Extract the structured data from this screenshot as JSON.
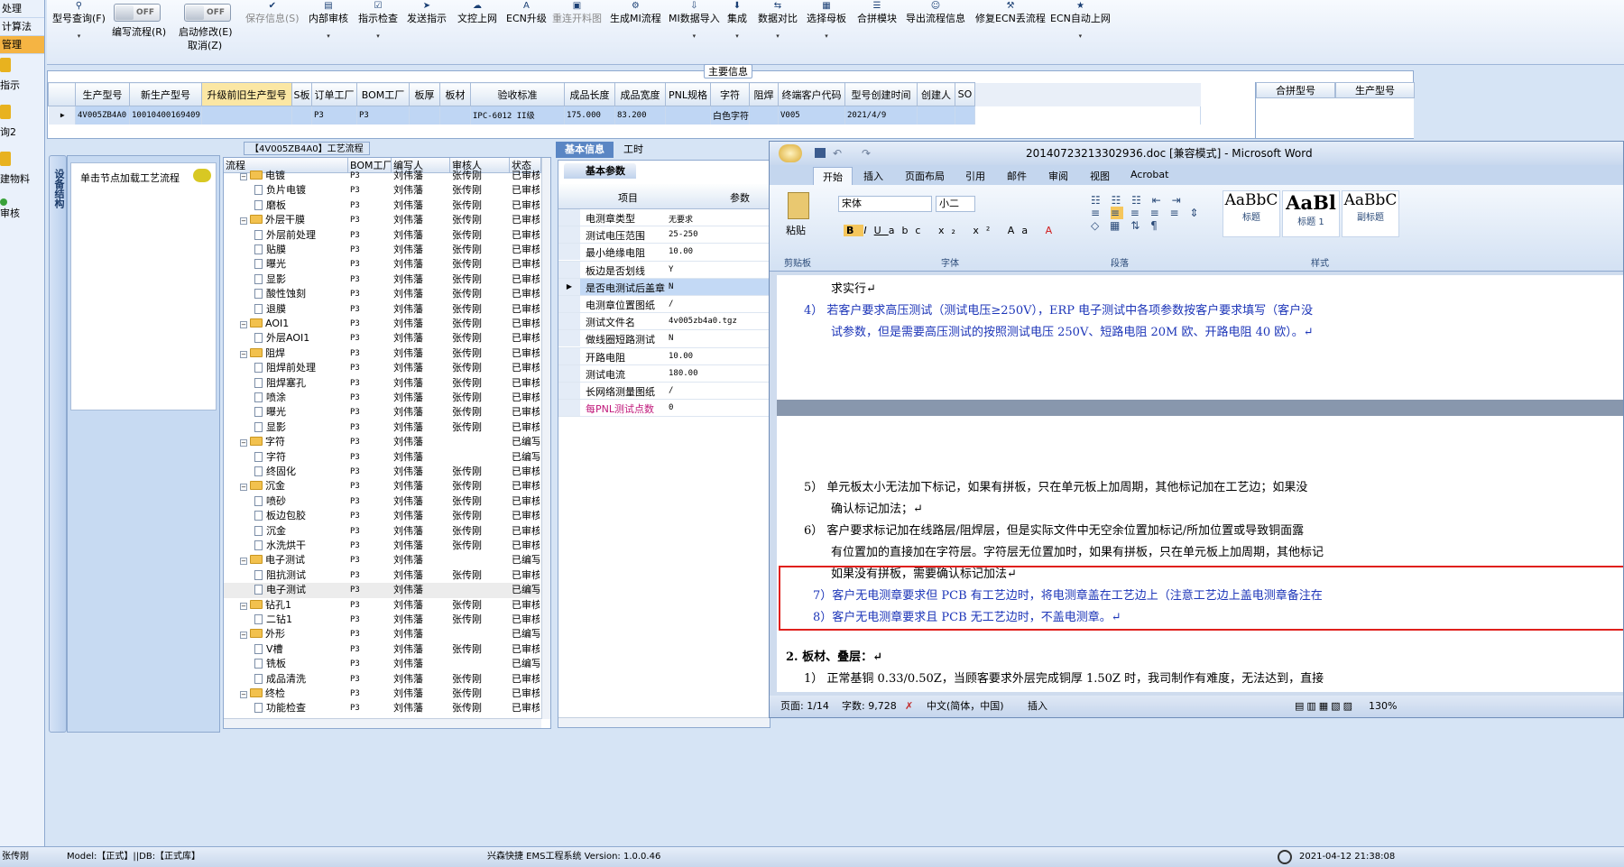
{
  "left_nav": {
    "items": [
      "处理",
      "计算法",
      "管理"
    ],
    "icon_items": [
      "指示",
      "询2",
      "建物料",
      "审核"
    ]
  },
  "toolbar": {
    "buttons": [
      {
        "label": "型号查询(F)",
        "icon": "search-icon",
        "disabled": false
      },
      {
        "label": "编写流程(R)",
        "icon": "toggle",
        "disabled": false
      },
      {
        "label": "启动修改(E)",
        "icon": "toggle",
        "disabled": false
      },
      {
        "label": "保存信息(S)",
        "icon": "check-icon",
        "disabled": true
      },
      {
        "label": "内部审核",
        "icon": "printer-icon",
        "disabled": false
      },
      {
        "label": "指示检查",
        "icon": "check-icon",
        "disabled": false
      },
      {
        "label": "发送指示",
        "icon": "send-icon",
        "disabled": false
      },
      {
        "label": "文控上网",
        "icon": "cloud-icon",
        "disabled": false
      },
      {
        "label": "ECN升级",
        "icon": "font-icon",
        "disabled": false
      },
      {
        "label": "重连开料图",
        "icon": "image-icon",
        "disabled": true
      },
      {
        "label": "生成MI流程",
        "icon": "gear-icon",
        "disabled": false
      },
      {
        "label": "MI数据导入",
        "icon": "import-icon",
        "disabled": false
      },
      {
        "label": "集成",
        "icon": "download-icon",
        "disabled": false
      },
      {
        "label": "数据对比",
        "icon": "compare-icon",
        "disabled": false
      },
      {
        "label": "选择母板",
        "icon": "board-icon",
        "disabled": false
      },
      {
        "label": "合拼模块",
        "icon": "list-icon",
        "disabled": false
      },
      {
        "label": "导出流程信息",
        "icon": "smile-icon",
        "disabled": false
      },
      {
        "label": "修复ECN丢流程",
        "icon": "wrench-icon",
        "disabled": false
      },
      {
        "label": "ECN自动上网",
        "icon": "star-icon",
        "disabled": false
      }
    ],
    "toggle_text": "OFF",
    "cancel_label": "取消(Z)"
  },
  "main_info": {
    "title": "主要信息",
    "columns": [
      "生产型号",
      "新生产型号",
      "升级前旧生产型号",
      "S板",
      "订单工厂",
      "BOM工厂",
      "板厚",
      "板材",
      "验收标准",
      "成品长度",
      "成品宽度",
      "PNL规格",
      "字符",
      "阻焊",
      "终端客户代码",
      "型号创建时间",
      "创建人",
      "SO"
    ],
    "row": [
      "4V005ZB4A0",
      "10010400169409",
      "",
      "",
      "P3",
      "P3",
      "",
      "",
      "IPC-6012 II级",
      "175.000",
      "83.200",
      "",
      "白色字符",
      "",
      "V005",
      "2021/4/9",
      "",
      ""
    ],
    "side_columns": [
      "合拼型号",
      "生产型号"
    ]
  },
  "node_panel": {
    "vtab_label": "设备结构",
    "node_label": "单击节点加载工艺流程"
  },
  "flow": {
    "title": "【4V005ZB4A0】工艺流程",
    "columns": [
      "流程",
      "BOM工厂",
      "编写人",
      "审核人",
      "状态"
    ],
    "rows": [
      {
        "name": "电镀",
        "level": 1,
        "type": "folder",
        "bom": "P3",
        "writer": "刘伟藩",
        "auditor": "张传刚",
        "status": "已审核"
      },
      {
        "name": "负片电镀",
        "level": 2,
        "type": "doc",
        "bom": "P3",
        "writer": "刘伟藩",
        "auditor": "张传刚",
        "status": "已审核"
      },
      {
        "name": "磨板",
        "level": 2,
        "type": "doc",
        "bom": "P3",
        "writer": "刘伟藩",
        "auditor": "张传刚",
        "status": "已审核"
      },
      {
        "name": "外层干膜",
        "level": 1,
        "type": "folder",
        "bom": "P3",
        "writer": "刘伟藩",
        "auditor": "张传刚",
        "status": "已审核"
      },
      {
        "name": "外层前处理",
        "level": 2,
        "type": "doc",
        "bom": "P3",
        "writer": "刘伟藩",
        "auditor": "张传刚",
        "status": "已审核"
      },
      {
        "name": "贴膜",
        "level": 2,
        "type": "doc",
        "bom": "P3",
        "writer": "刘伟藩",
        "auditor": "张传刚",
        "status": "已审核"
      },
      {
        "name": "曝光",
        "level": 2,
        "type": "doc",
        "bom": "P3",
        "writer": "刘伟藩",
        "auditor": "张传刚",
        "status": "已审核"
      },
      {
        "name": "显影",
        "level": 2,
        "type": "doc",
        "bom": "P3",
        "writer": "刘伟藩",
        "auditor": "张传刚",
        "status": "已审核"
      },
      {
        "name": "酸性蚀刻",
        "level": 2,
        "type": "doc",
        "bom": "P3",
        "writer": "刘伟藩",
        "auditor": "张传刚",
        "status": "已审核"
      },
      {
        "name": "退膜",
        "level": 2,
        "type": "doc",
        "bom": "P3",
        "writer": "刘伟藩",
        "auditor": "张传刚",
        "status": "已审核"
      },
      {
        "name": "AOI1",
        "level": 1,
        "type": "folder",
        "bom": "P3",
        "writer": "刘伟藩",
        "auditor": "张传刚",
        "status": "已审核"
      },
      {
        "name": "外层AOI1",
        "level": 2,
        "type": "doc",
        "bom": "P3",
        "writer": "刘伟藩",
        "auditor": "张传刚",
        "status": "已审核"
      },
      {
        "name": "阻焊",
        "level": 1,
        "type": "folder",
        "bom": "P3",
        "writer": "刘伟藩",
        "auditor": "张传刚",
        "status": "已审核"
      },
      {
        "name": "阻焊前处理",
        "level": 2,
        "type": "doc",
        "bom": "P3",
        "writer": "刘伟藩",
        "auditor": "张传刚",
        "status": "已审核"
      },
      {
        "name": "阻焊塞孔",
        "level": 2,
        "type": "doc",
        "bom": "P3",
        "writer": "刘伟藩",
        "auditor": "张传刚",
        "status": "已审核"
      },
      {
        "name": "喷涂",
        "level": 2,
        "type": "doc",
        "bom": "P3",
        "writer": "刘伟藩",
        "auditor": "张传刚",
        "status": "已审核"
      },
      {
        "name": "曝光",
        "level": 2,
        "type": "doc",
        "bom": "P3",
        "writer": "刘伟藩",
        "auditor": "张传刚",
        "status": "已审核"
      },
      {
        "name": "显影",
        "level": 2,
        "type": "doc",
        "bom": "P3",
        "writer": "刘伟藩",
        "auditor": "张传刚",
        "status": "已审核"
      },
      {
        "name": "字符",
        "level": 1,
        "type": "folder",
        "bom": "P3",
        "writer": "刘伟藩",
        "auditor": "",
        "status": "已编写"
      },
      {
        "name": "字符",
        "level": 2,
        "type": "doc",
        "bom": "P3",
        "writer": "刘伟藩",
        "auditor": "",
        "status": "已编写"
      },
      {
        "name": "终固化",
        "level": 2,
        "type": "doc",
        "bom": "P3",
        "writer": "刘伟藩",
        "auditor": "张传刚",
        "status": "已审核"
      },
      {
        "name": "沉金",
        "level": 1,
        "type": "folder",
        "bom": "P3",
        "writer": "刘伟藩",
        "auditor": "张传刚",
        "status": "已审核"
      },
      {
        "name": "喷砂",
        "level": 2,
        "type": "doc",
        "bom": "P3",
        "writer": "刘伟藩",
        "auditor": "张传刚",
        "status": "已审核"
      },
      {
        "name": "板边包胶",
        "level": 2,
        "type": "doc",
        "bom": "P3",
        "writer": "刘伟藩",
        "auditor": "张传刚",
        "status": "已审核"
      },
      {
        "name": "沉金",
        "level": 2,
        "type": "doc",
        "bom": "P3",
        "writer": "刘伟藩",
        "auditor": "张传刚",
        "status": "已审核"
      },
      {
        "name": "水洗烘干",
        "level": 2,
        "type": "doc",
        "bom": "P3",
        "writer": "刘伟藩",
        "auditor": "张传刚",
        "status": "已审核"
      },
      {
        "name": "电子测试",
        "level": 1,
        "type": "folder",
        "bom": "P3",
        "writer": "刘伟藩",
        "auditor": "",
        "status": "已编写"
      },
      {
        "name": "阻抗测试",
        "level": 2,
        "type": "doc",
        "bom": "P3",
        "writer": "刘伟藩",
        "auditor": "张传刚",
        "status": "已审核"
      },
      {
        "name": "电子测试",
        "level": 2,
        "type": "doc",
        "bom": "P3",
        "writer": "刘伟藩",
        "auditor": "",
        "status": "已编写",
        "selected": true
      },
      {
        "name": "钻孔1",
        "level": 1,
        "type": "folder",
        "bom": "P3",
        "writer": "刘伟藩",
        "auditor": "张传刚",
        "status": "已审核"
      },
      {
        "name": "二钻1",
        "level": 2,
        "type": "doc",
        "bom": "P3",
        "writer": "刘伟藩",
        "auditor": "张传刚",
        "status": "已审核"
      },
      {
        "name": "外形",
        "level": 1,
        "type": "folder",
        "bom": "P3",
        "writer": "刘伟藩",
        "auditor": "",
        "status": "已编写"
      },
      {
        "name": "V槽",
        "level": 2,
        "type": "doc",
        "bom": "P3",
        "writer": "刘伟藩",
        "auditor": "张传刚",
        "status": "已审核"
      },
      {
        "name": "铣板",
        "level": 2,
        "type": "doc",
        "bom": "P3",
        "writer": "刘伟藩",
        "auditor": "",
        "status": "已编写"
      },
      {
        "name": "成品清洗",
        "level": 2,
        "type": "doc",
        "bom": "P3",
        "writer": "刘伟藩",
        "auditor": "张传刚",
        "status": "已审核"
      },
      {
        "name": "终检",
        "level": 1,
        "type": "folder",
        "bom": "P3",
        "writer": "刘伟藩",
        "auditor": "张传刚",
        "status": "已审核"
      },
      {
        "name": "功能检查",
        "level": 2,
        "type": "doc",
        "bom": "P3",
        "writer": "刘伟藩",
        "auditor": "张传刚",
        "status": "已审核"
      }
    ]
  },
  "params": {
    "tabs": [
      "基本信息",
      "工时"
    ],
    "subtab": "基本参数",
    "col_item": "项目",
    "col_param": "参数",
    "rows": [
      {
        "k": "电测章类型",
        "v": "无要求"
      },
      {
        "k": "测试电压范围",
        "v": "25-250"
      },
      {
        "k": "最小绝缘电阻",
        "v": "10.00"
      },
      {
        "k": "板边是否划线",
        "v": "Y"
      },
      {
        "k": "是否电测试后盖章",
        "v": "N",
        "selected": true
      },
      {
        "k": "电测章位置图纸",
        "v": "/"
      },
      {
        "k": "测试文件名",
        "v": "4v005zb4a0.tgz"
      },
      {
        "k": "做线圈短路测试",
        "v": "N"
      },
      {
        "k": "开路电阻",
        "v": "10.00"
      },
      {
        "k": "测试电流",
        "v": "180.00"
      },
      {
        "k": "长网络测量图纸",
        "v": "/"
      },
      {
        "k": "每PNL测试点数",
        "v": "0",
        "highlight": true
      }
    ]
  },
  "word": {
    "title": "20140723213302936.doc [兼容模式] - Microsoft Word",
    "tabs": [
      "开始",
      "插入",
      "页面布局",
      "引用",
      "邮件",
      "审阅",
      "视图",
      "Acrobat"
    ],
    "groups": [
      "剪贴板",
      "字体",
      "段落",
      "样式"
    ],
    "paste_label": "粘贴",
    "font_name": "宋体",
    "font_size": "小二",
    "styles": [
      {
        "sample": "AaBbC",
        "name": "标题"
      },
      {
        "sample": "AaBl",
        "name": "标题 1"
      },
      {
        "sample": "AaBbC",
        "name": "副标题"
      }
    ],
    "lines_page1": [
      "求实行↵",
      "4） 若客户要求高压测试（测试电压≥250V），ERP 电子测试中各项参数按客户要求填写（客户没",
      "试参数，但是需要高压测试的按照测试电压 250V、短路电阻 20M 欧、开路电阻 40 欧）。↵"
    ],
    "lines_page2": [
      "5） 单元板太小无法加下标记，如果有拼板，只在单元板上加周期，其他标记加在工艺边；如果没",
      "确认标记加法；↵",
      "6） 客户要求标记加在线路层/阻焊层，但是实际文件中无空余位置加标记/所加位置或导致铜面露",
      "有位置加的直接加在字符层。字符层无位置加时，如果有拼板，只在单元板上加周期，其他标记",
      "如果没有拼板，需要确认标记加法↵",
      "7）客户无电测章要求但 PCB 有工艺边时，将电测章盖在工艺边上（注意工艺边上盖电测章备注在",
      "8）客户无电测章要求且 PCB 无工艺边时，不盖电测章。↵",
      "2.   板材、叠层：↵",
      "1） 正常基铜 0.33/0.50Z，当顾客要求外层完成铜厚 1.50Z 时，我司制作有难度，无法达到，直接"
    ],
    "status": {
      "page": "页面: 1/14",
      "words": "字数: 9,728",
      "lang": "中文(简体，中国)",
      "mode": "插入",
      "zoom": "130%"
    }
  },
  "statusbar": {
    "user": "张传刚",
    "model_db": "Model:【正式】||DB:【正式库】",
    "app": "兴森快捷 EMS工程系统 Version: 1.0.0.46",
    "datetime": "2021-04-12 21:38:08"
  },
  "colors": {
    "selected_row": "#bfd6f4",
    "highlight_text": "#c0177a",
    "annotation_box": "#e0201c",
    "doc_blue": "#1c35b8"
  }
}
